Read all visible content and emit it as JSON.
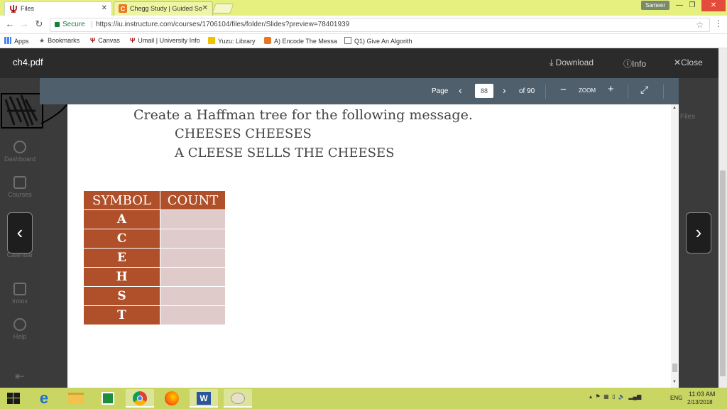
{
  "browser": {
    "tabs": [
      {
        "title": "Files",
        "active": true
      },
      {
        "title": "Chegg Study | Guided So",
        "active": false
      }
    ],
    "user": "Sameer",
    "secure_label": "Secure",
    "url": "https://iu.instructure.com/courses/1706104/files/folder/Slides?preview=78401939",
    "bookmarks": [
      "Apps",
      "Bookmarks",
      "Canvas",
      "Umail | University Info",
      "Yuzu: Library",
      "A) Encode The Messa",
      "Q1) Give An Algorith"
    ]
  },
  "sidenav": {
    "items": [
      "Dashboard",
      "Courses",
      "Calendar",
      "Inbox",
      "Help"
    ]
  },
  "viewer": {
    "filename": "ch4.pdf",
    "download": "Download",
    "info": "Info",
    "close": "Close",
    "page_label": "Page",
    "page_current": "88",
    "page_total": "of 90",
    "zoom_label": "ZOOM",
    "right_label": "Files"
  },
  "pdf": {
    "line1": "Create a Haffman tree for the following message.",
    "line2": "CHEESES CHEESES",
    "line3": "A CLEESE SELLS THE CHEESES",
    "table": {
      "headers": [
        "SYMBOL",
        "COUNT"
      ],
      "rows": [
        {
          "symbol": "A",
          "count": ""
        },
        {
          "symbol": "C",
          "count": ""
        },
        {
          "symbol": "E",
          "count": ""
        },
        {
          "symbol": "H",
          "count": ""
        },
        {
          "symbol": "S",
          "count": ""
        },
        {
          "symbol": "T",
          "count": ""
        }
      ]
    }
  },
  "taskbar": {
    "lang": "ENG",
    "time": "11:03 AM",
    "date": "2/13/2018"
  },
  "colors": {
    "tab_bar": "#e6f07e",
    "pdf_toolbar": "#4f5f6c",
    "table_header": "#b0502a",
    "table_count_cell": "#e0cbcb"
  }
}
